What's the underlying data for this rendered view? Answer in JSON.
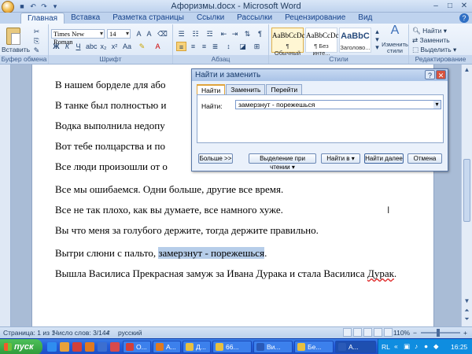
{
  "window": {
    "title": "Афоризмы.docx - Microsoft Word",
    "controls": [
      "–",
      "□",
      "✕"
    ]
  },
  "ribbon": {
    "tabs": [
      "Главная",
      "Вставка",
      "Разметка страницы",
      "Ссылки",
      "Рассылки",
      "Рецензирование",
      "Вид"
    ],
    "clipboard": {
      "paste_label": "Вставить",
      "group_label": "Буфер обмена"
    },
    "font": {
      "name": "Times New Roman",
      "size": "14",
      "group_label": "Шрифт",
      "bold": "Ж",
      "italic": "К",
      "underline": "Ч"
    },
    "paragraph": {
      "group_label": "Абзац"
    },
    "styles": {
      "group_label": "Стили",
      "items": [
        {
          "sample": "AaBbCcDc",
          "name": "¶ Обычный"
        },
        {
          "sample": "AaBbCcDc",
          "name": "¶ Без инте..."
        },
        {
          "sample": "AaBbC",
          "name": "Заголово..."
        }
      ],
      "change_label": "Изменить стили"
    },
    "editing": {
      "group_label": "Редактирование",
      "find": "Найти",
      "replace": "Заменить",
      "select": "Выделить"
    }
  },
  "document": {
    "lines": [
      "В нашем борделе для або",
      "В танке был полностью и",
      "Водка выполнила недопу",
      "Вот тебе полцарства и по",
      "Все люди произошли от о",
      "Все мы ошибаемся. Одни больше, другие все время.",
      "Все не так плохо, как вы думаете, все намного хуже.",
      "Вы что меня за голубого держите, тогда держите правильно."
    ],
    "line9_prefix": "Вытри слюни с пальто, ",
    "line9_highlight": "замерзнут - порежешься",
    "line9_suffix": ".",
    "line10_prefix": "Вышла Василиса Прекрасная замуж за Ивана Дурака и стала Василиса ",
    "line10_squiggle": "Дурак",
    "line10_suffix": "."
  },
  "dialog": {
    "title": "Найти и заменить",
    "tabs": [
      "Найти",
      "Заменить",
      "Перейти"
    ],
    "find_label": "Найти:",
    "find_value": "замерзнут - порежешься",
    "buttons": {
      "more": "Больше >>",
      "reading_highlight": "Выделение при чтении ▾",
      "find_in": "Найти в ▾",
      "find_next": "Найти далее",
      "cancel": "Отмена"
    }
  },
  "statusbar": {
    "page": "Страница: 1 из 1",
    "words": "Число слов: 3/144",
    "language": "русский",
    "zoom": "110%"
  },
  "taskbar": {
    "start": "пуск",
    "tasks": [
      "О...",
      "А...",
      "Д...",
      "66...",
      "Ви...",
      "Бе...",
      "А..."
    ],
    "tray_lang": "RL",
    "clock": "16:25"
  }
}
